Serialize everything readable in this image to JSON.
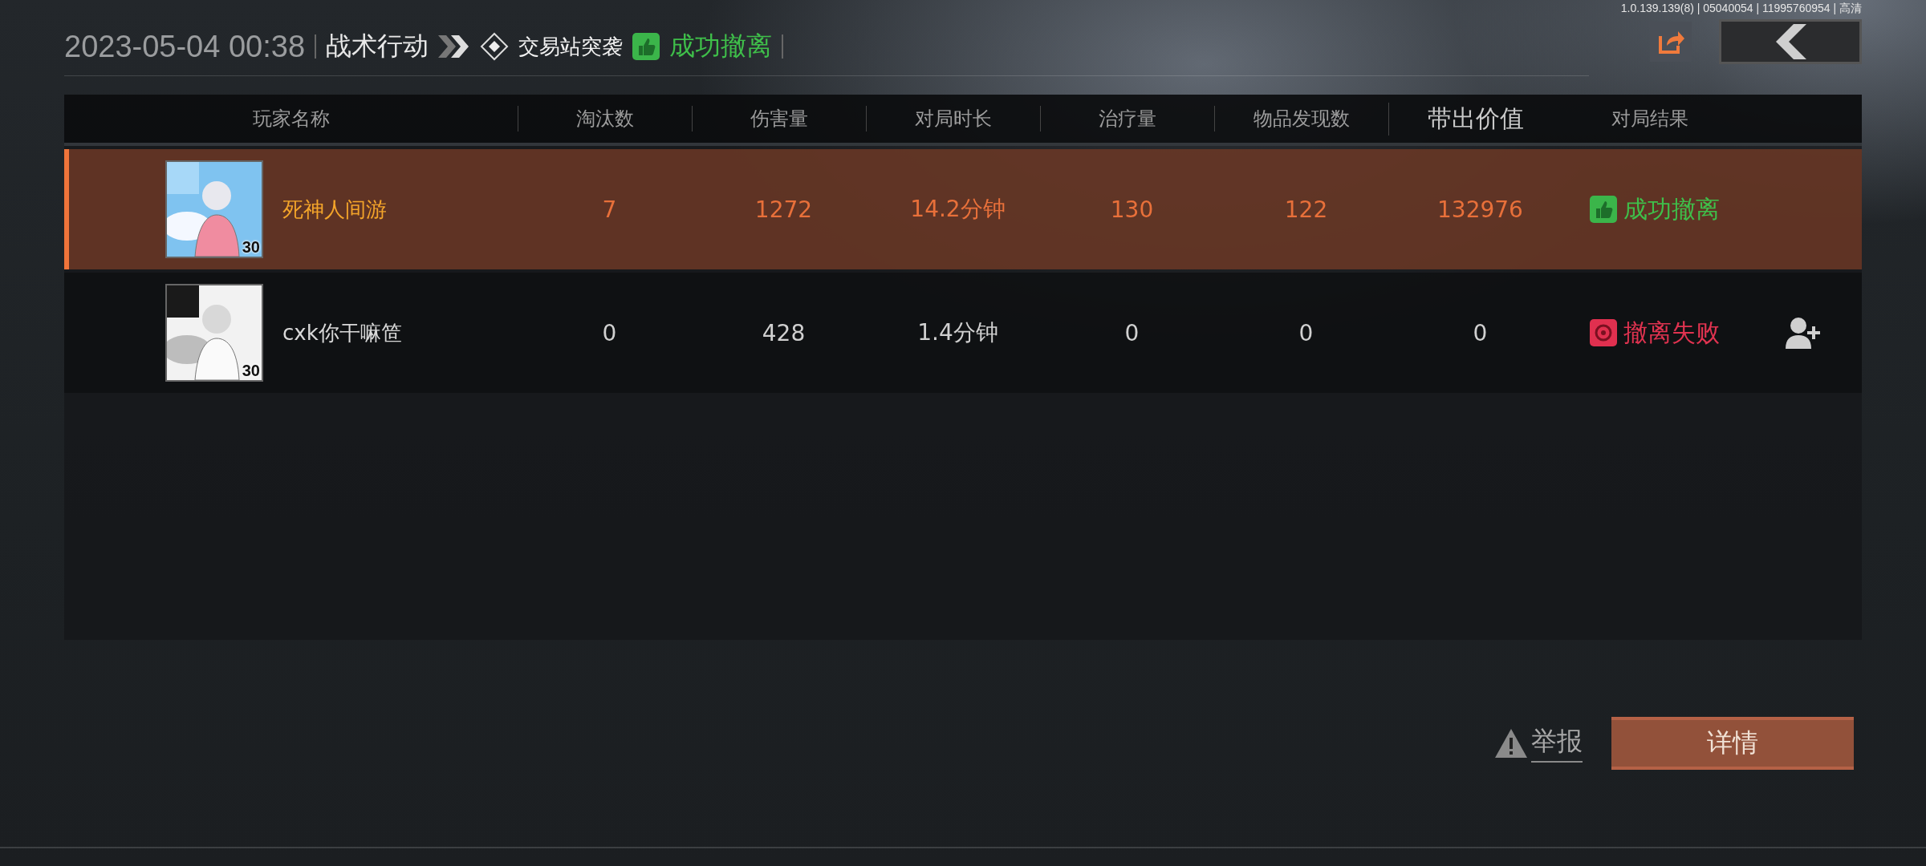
{
  "build_info": "1.0.139.139(8) | 05040054 | 11995760954 | 高清",
  "header": {
    "datetime": "2023-05-04 00:38",
    "mode": "战术行动",
    "map": "交易站突袭",
    "result": {
      "kind": "success",
      "label": "成功撤离"
    }
  },
  "table": {
    "columns": [
      {
        "label": "玩家名称",
        "emphasized": false
      },
      {
        "label": "淘汰数",
        "emphasized": false
      },
      {
        "label": "伤害量",
        "emphasized": false
      },
      {
        "label": "对局时长",
        "emphasized": false
      },
      {
        "label": "治疗量",
        "emphasized": false
      },
      {
        "label": "物品发现数",
        "emphasized": false
      },
      {
        "label": "带出价值",
        "emphasized": true
      },
      {
        "label": "对局结果",
        "emphasized": false
      }
    ],
    "rows": [
      {
        "selected": true,
        "name": "死神人间游",
        "level": "30",
        "stats": [
          "7",
          "1272",
          "14.2分钟",
          "130",
          "122",
          "132976"
        ],
        "result": {
          "kind": "success",
          "label": "成功撤离"
        },
        "can_add_friend": false
      },
      {
        "selected": false,
        "name": "cxk你干嘛笸",
        "level": "30",
        "stats": [
          "0",
          "428",
          "1.4分钟",
          "0",
          "0",
          "0"
        ],
        "result": {
          "kind": "fail",
          "label": "撤离失败"
        },
        "can_add_friend": true
      }
    ]
  },
  "actions": {
    "report": "举报",
    "details": "详情"
  }
}
